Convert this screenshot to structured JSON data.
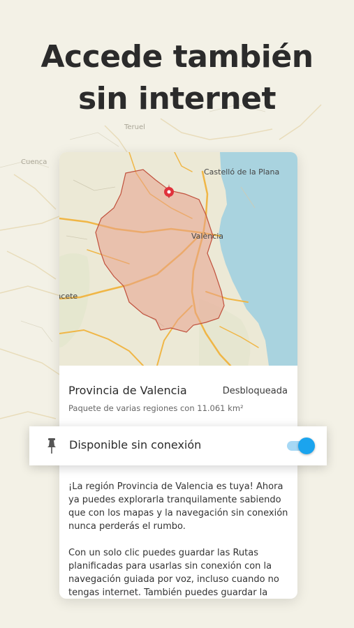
{
  "headline": {
    "line1": "Accede también",
    "line2": "sin internet"
  },
  "background_map": {
    "labels": {
      "teruel": "Teruel",
      "cuenca": "Cuenca"
    }
  },
  "card": {
    "map": {
      "labels": {
        "castellon": "Castelló de la Plana",
        "valencia": "València",
        "albacete": "Albacete"
      }
    },
    "region_title": "Provincia de Valencia",
    "status": "Desbloqueada",
    "subtitle": "Paquete de varias regiones con 11.061 km²",
    "description_p1": "¡La región Provincia de Valencia es tuya! Ahora ya puedes explorarla tranquilamente sabiendo que con los mapas y la navegación sin conexión nunca perderás el rumbo.",
    "description_p2": "Con un solo clic puedes guardar las Rutas planificadas para usarlas sin conexión con la navegación guiada por voz, incluso cuando no tengas internet. También puedes guardar la región"
  },
  "offline_bar": {
    "label": "Disponible sin conexión",
    "toggle_on": true,
    "icon": "pin-icon"
  },
  "colors": {
    "background": "#f3f1e6",
    "sea": "#a9d3df",
    "land": "#ece9d6",
    "region_fill": "#e8a08c",
    "region_stroke": "#c0503c",
    "roads": "#f0b646",
    "marker": "#e0323c",
    "toggle_knob": "#1ba4ee",
    "toggle_track": "#a6d8f5"
  }
}
